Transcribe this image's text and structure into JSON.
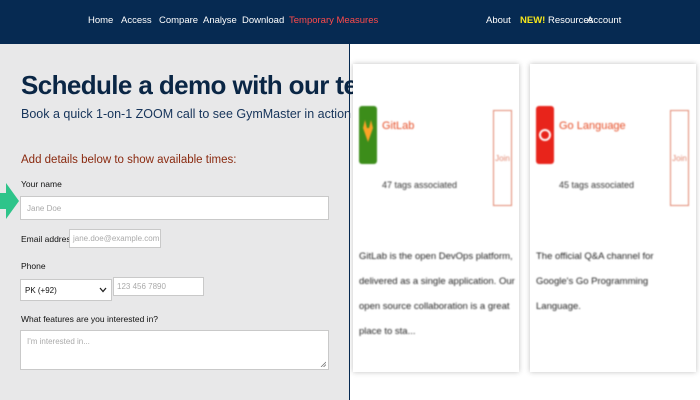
{
  "nav": {
    "left_items": [
      "Home",
      "Access",
      "Compare",
      "Analyse",
      "Download",
      "Temporary Measures"
    ],
    "about": "About",
    "new_tag": "NEW!",
    "resources": "Resources",
    "account": "Account"
  },
  "form": {
    "title": "Schedule a demo with our team",
    "subtitle": "Book a quick 1-on-1 ZOOM call to see GymMaster in action",
    "prompt": "Add details below to show available times:",
    "name_label": "Your name",
    "name_placeholder": "Jane Doe",
    "email_label": "Email address",
    "email_placeholder": "jane.doe@example.com",
    "phone_label": "Phone",
    "country_value": "PK (+92)",
    "phone_placeholder": "123 456 7890",
    "features_label": "What features are you interested in?",
    "features_placeholder": "I'm interested in..."
  },
  "cards": [
    {
      "name": "GitLab",
      "tags": "47 tags associated",
      "join": "Join",
      "description": "GitLab is the open DevOps platform, delivered as a single application. Our open source collaboration is a great place to sta...",
      "logo_color": "#3c8d1a",
      "logo_icon": "gitlab-logo-icon"
    },
    {
      "name": "Go Language",
      "tags": "45 tags associated",
      "join": "Join",
      "description": "The official Q&A channel for Google's Go Programming Language.",
      "logo_color": "#e8241b",
      "logo_icon": "go-logo-icon"
    }
  ],
  "colors": {
    "nav_bg": "#062a52",
    "active_nav": "#ff4a4a",
    "new_tag": "#f5e61c",
    "arrow": "#2ec48a",
    "card_accent": "#e54d26"
  }
}
